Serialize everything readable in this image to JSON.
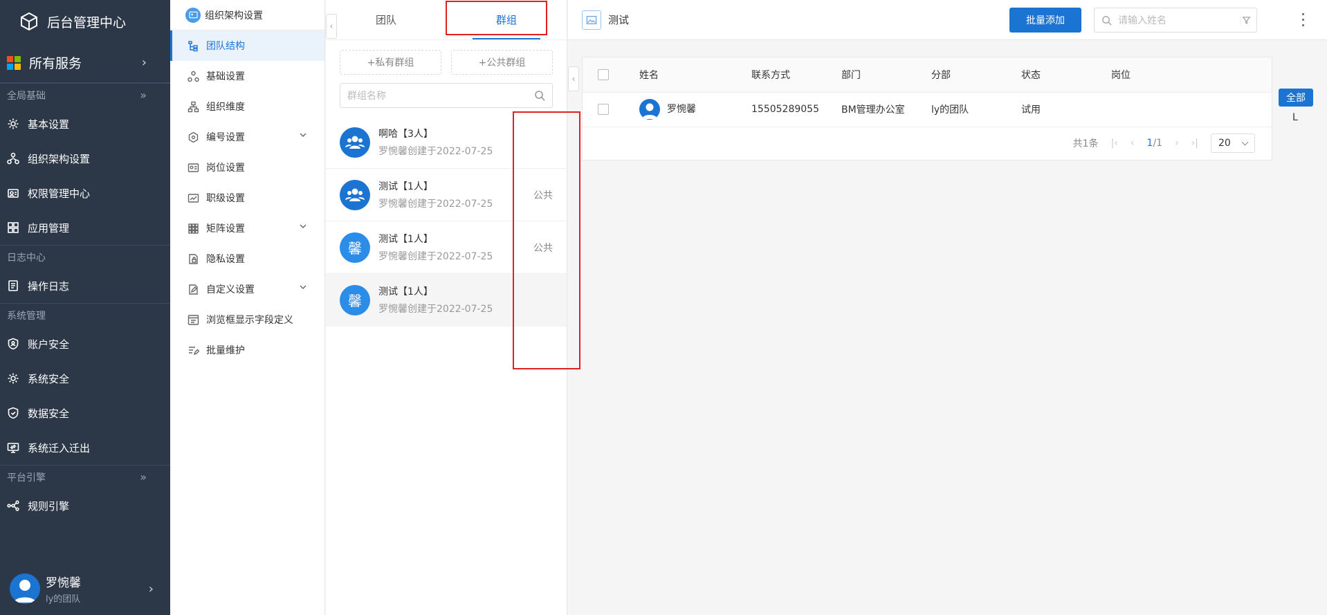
{
  "nav": {
    "brand": "后台管理中心",
    "all_services": "所有服务",
    "groups": [
      {
        "label": "全局基础",
        "items": [
          "基本设置",
          "组织架构设置",
          "权限管理中心",
          "应用管理"
        ]
      },
      {
        "label": "日志中心",
        "items": [
          "操作日志"
        ]
      },
      {
        "label": "系统管理",
        "items": [
          "账户安全",
          "系统安全",
          "数据安全",
          "系统迁入迁出"
        ]
      },
      {
        "label": "平台引擎",
        "items": [
          "规则引擎"
        ]
      }
    ],
    "user": {
      "name": "罗惋馨",
      "team": "ly的团队"
    }
  },
  "menu2": {
    "title": "组织架构设置",
    "items": [
      "团队结构",
      "基础设置",
      "组织维度",
      "编号设置",
      "岗位设置",
      "职级设置",
      "矩阵设置",
      "隐私设置",
      "自定义设置",
      "浏览框显示字段定义",
      "批量维护"
    ]
  },
  "group_panel": {
    "tabs": [
      "团队",
      "群组"
    ],
    "add_private": "+私有群组",
    "add_public": "+公共群组",
    "search_placeholder": "群组名称",
    "groups": [
      {
        "name": "啊哈【3人】",
        "sub": "罗惋馨创建于2022-07-25",
        "tag": "",
        "avatar": "group"
      },
      {
        "name": "测试【1人】",
        "sub": "罗惋馨创建于2022-07-25",
        "tag": "公共",
        "avatar": "group"
      },
      {
        "name": "测试【1人】",
        "sub": "罗惋馨创建于2022-07-25",
        "tag": "公共",
        "avatar": "馨"
      },
      {
        "name": "测试【1人】",
        "sub": "罗惋馨创建于2022-07-25",
        "tag": "",
        "avatar": "馨"
      }
    ]
  },
  "main": {
    "title": "测试",
    "add_button": "批量添加",
    "search_placeholder": "请输入姓名",
    "columns": [
      "姓名",
      "联系方式",
      "部门",
      "分部",
      "状态",
      "岗位"
    ],
    "rows": [
      {
        "name": "罗惋馨",
        "phone": "15505289055",
        "dept": "BM管理办公室",
        "branch": "ly的团队",
        "status": "试用",
        "post": ""
      }
    ],
    "pager": {
      "total": "共1条",
      "current": "1",
      "pages": "/1",
      "page_size": "20"
    },
    "side_tag": "全部",
    "side_letter": "L"
  },
  "colors": {
    "nav_bg": "#2c3848",
    "accent": "#1b73d2",
    "highlight": "#e02020"
  }
}
